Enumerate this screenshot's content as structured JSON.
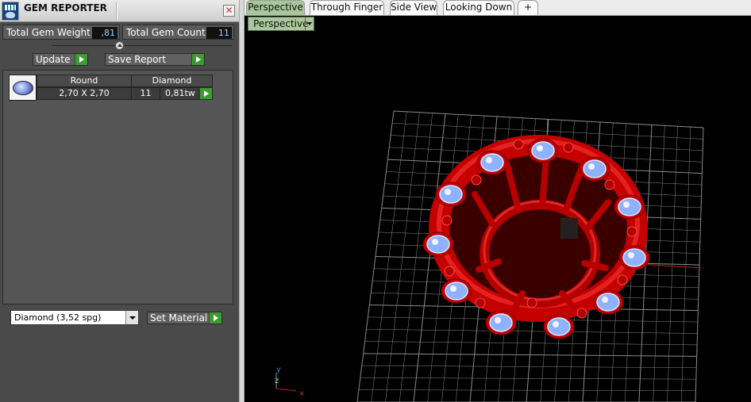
{
  "panel": {
    "title": "GEM REPORTER",
    "close_glyph": "✕",
    "total_gem_weight_label": "Total Gem Weight",
    "total_gem_weight_value": ",81",
    "total_gem_count_label": "Total Gem Count",
    "total_gem_count_value": "11",
    "update_label": "Update",
    "save_report_label": "Save Report",
    "table": {
      "headers": [
        "Round",
        "Diamond"
      ],
      "row": {
        "size": "2,70 X 2,70",
        "count": "11",
        "weight": "0,81tw"
      }
    },
    "material_select_value": "Diamond      (3,52 spg)",
    "set_material_label": "Set Material"
  },
  "tabs": [
    {
      "label": "Perspective",
      "active": true
    },
    {
      "label": "Through Finger",
      "active": false
    },
    {
      "label": "Side View",
      "active": false
    },
    {
      "label": "Looking Down",
      "active": false
    },
    {
      "label": "+",
      "active": false
    }
  ],
  "viewport": {
    "view_dropdown_label": "Perspective",
    "axis_labels": {
      "y": "y",
      "z": "z",
      "x": "x"
    },
    "colors": {
      "ring": "#cc0000",
      "gem": "#8fb2ff",
      "grid": "#8a8a8a",
      "axis_x": "#b52020",
      "axis_y": "#2fb3b3"
    }
  },
  "icons": [
    "app-icon",
    "close-icon",
    "dropdown-arrow-icon",
    "play-arrow-icon",
    "add-tab-icon",
    "gem-oval-icon",
    "axis-triad-icon"
  ]
}
